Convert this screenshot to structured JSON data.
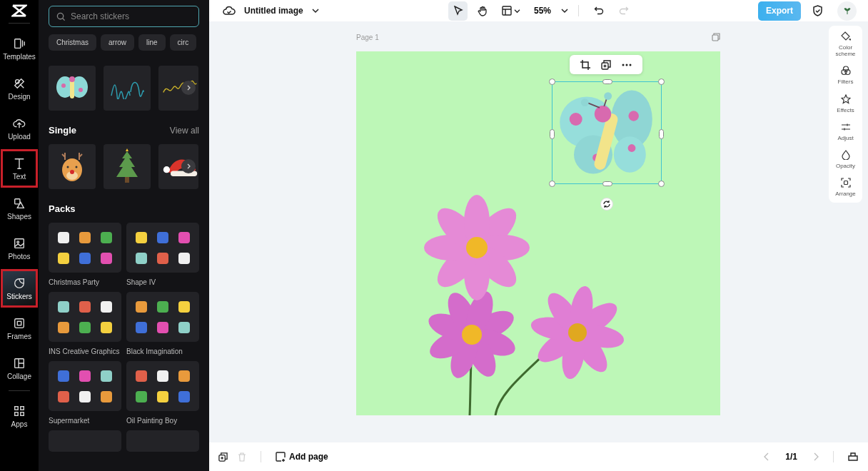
{
  "rail": {
    "items": [
      {
        "label": "Templates",
        "selected": false,
        "highlighted": false
      },
      {
        "label": "Design",
        "selected": false,
        "highlighted": false
      },
      {
        "label": "Upload",
        "selected": false,
        "highlighted": false
      },
      {
        "label": "Text",
        "selected": false,
        "highlighted": true
      },
      {
        "label": "Shapes",
        "selected": false,
        "highlighted": false
      },
      {
        "label": "Photos",
        "selected": false,
        "highlighted": false
      },
      {
        "label": "Stickers",
        "selected": true,
        "highlighted": true
      },
      {
        "label": "Frames",
        "selected": false,
        "highlighted": false
      },
      {
        "label": "Collage",
        "selected": false,
        "highlighted": false
      },
      {
        "label": "Apps",
        "selected": false,
        "highlighted": false
      }
    ]
  },
  "sticker_panel": {
    "search": {
      "placeholder": "Search stickers"
    },
    "chips": [
      "Christmas",
      "arrow",
      "line",
      "circ"
    ],
    "single": {
      "title": "Single",
      "view_all": "View all"
    },
    "packs": {
      "title": "Packs",
      "items": [
        {
          "name": "Christmas Party"
        },
        {
          "name": "Shape IV"
        },
        {
          "name": "INS Creative Graphics"
        },
        {
          "name": "Black Imagination"
        },
        {
          "name": "Supermarket"
        },
        {
          "name": "Oil Painting Boy"
        }
      ]
    }
  },
  "topbar": {
    "title": "Untitled image",
    "zoom": "55%",
    "redo_disabled": true,
    "export": "Export"
  },
  "canvas": {
    "page_label": "Page 1"
  },
  "right_panel": {
    "items": [
      {
        "label": "Color scheme"
      },
      {
        "label": "Filters"
      },
      {
        "label": "Effects"
      },
      {
        "label": "Adjust"
      },
      {
        "label": "Opacity"
      },
      {
        "label": "Arrange"
      }
    ]
  },
  "bottom_bar": {
    "delete_disabled": true,
    "add_page": "Add page",
    "page_count": "1/1"
  }
}
